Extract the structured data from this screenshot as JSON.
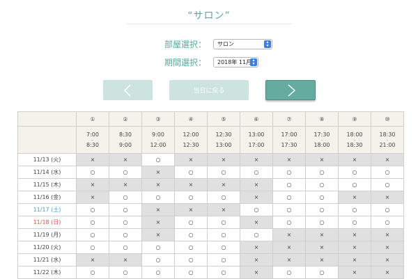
{
  "title": "“サロン”",
  "room_select": {
    "label": "部屋選択：",
    "value": "サロン"
  },
  "period_select": {
    "label": "期間選択：",
    "value": "2018年 11月"
  },
  "buttons": {
    "today": "当日に戻る"
  },
  "slots": [
    {
      "num": "①",
      "start": "7:00",
      "end": "8:30"
    },
    {
      "num": "②",
      "start": "8:30",
      "end": "9:00"
    },
    {
      "num": "③",
      "start": "9:00",
      "end": "12:00"
    },
    {
      "num": "④",
      "start": "12:00",
      "end": "12:30"
    },
    {
      "num": "⑤",
      "start": "12:30",
      "end": "13:00"
    },
    {
      "num": "⑥",
      "start": "13:00",
      "end": "17:00"
    },
    {
      "num": "⑦",
      "start": "17:00",
      "end": "17:30"
    },
    {
      "num": "⑧",
      "start": "17:30",
      "end": "18:00"
    },
    {
      "num": "⑨",
      "start": "18:00",
      "end": "18:30"
    },
    {
      "num": "⑩",
      "start": "18:30",
      "end": "21:00"
    }
  ],
  "time_separator": "-",
  "days": [
    {
      "date": "11/13 (火)",
      "type": "weekday",
      "cells": [
        "×",
        "×",
        "○",
        "×",
        "×",
        "×",
        "×",
        "×",
        "×",
        "×"
      ]
    },
    {
      "date": "11/14 (水)",
      "type": "weekday",
      "cells": [
        "○",
        "○",
        "×",
        "○",
        "○",
        "○",
        "○",
        "○",
        "○",
        "○"
      ]
    },
    {
      "date": "11/15 (木)",
      "type": "weekday",
      "cells": [
        "×",
        "×",
        "×",
        "×",
        "×",
        "×",
        "○",
        "○",
        "○",
        "○"
      ]
    },
    {
      "date": "11/16 (金)",
      "type": "weekday",
      "cells": [
        "×",
        "○",
        "○",
        "○",
        "○",
        "×",
        "○",
        "○",
        "×",
        "×"
      ]
    },
    {
      "date": "11/17 (土)",
      "type": "sat",
      "cells": [
        "○",
        "○",
        "×",
        "×",
        "×",
        "○",
        "○",
        "○",
        "○",
        "○"
      ]
    },
    {
      "date": "11/18 (日)",
      "type": "sun",
      "cells": [
        "○",
        "○",
        "×",
        "○",
        "○",
        "×",
        "○",
        "○",
        "○",
        "○"
      ]
    },
    {
      "date": "11/19 (月)",
      "type": "weekday",
      "cells": [
        "○",
        "○",
        "×",
        "○",
        "○",
        "○",
        "×",
        "×",
        "×",
        "×"
      ]
    },
    {
      "date": "11/20 (火)",
      "type": "weekday",
      "cells": [
        "○",
        "○",
        "○",
        "○",
        "○",
        "×",
        "×",
        "×",
        "×",
        "×"
      ]
    },
    {
      "date": "11/21 (水)",
      "type": "weekday",
      "cells": [
        "×",
        "×",
        "○",
        "○",
        "○",
        "×",
        "×",
        "×",
        "×",
        "×"
      ]
    },
    {
      "date": "11/22 (木)",
      "type": "weekday",
      "cells": [
        "○",
        "○",
        "○",
        "○",
        "○",
        "×",
        "○",
        "○",
        "×",
        "×"
      ]
    }
  ],
  "colors": {
    "accent": "#5aa89c",
    "next_button": "#66aba0",
    "disabled_button": "#cde3df",
    "unavailable": "#e0e0e0",
    "saturday": "#4a9bd8",
    "sunday": "#e0524d"
  }
}
